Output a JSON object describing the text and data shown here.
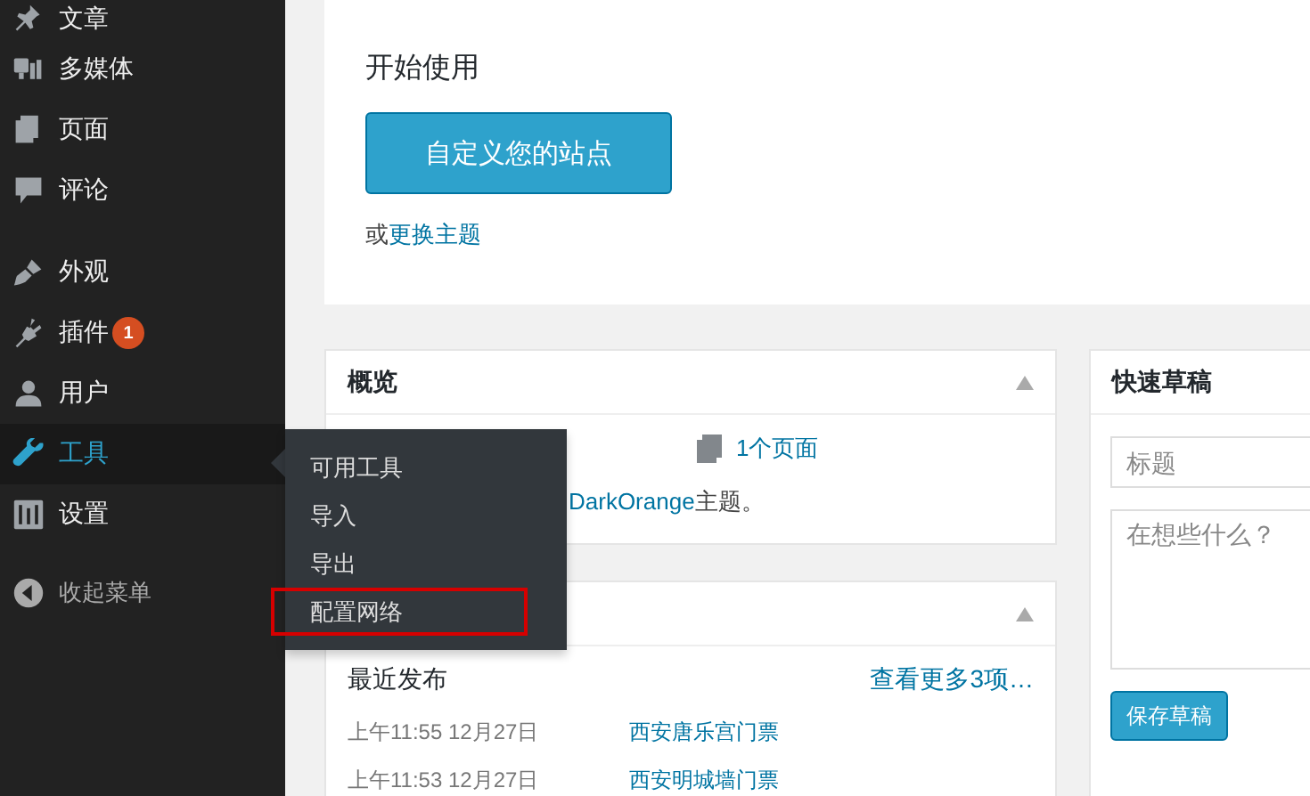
{
  "sidebar": {
    "items": [
      {
        "label": "文章",
        "selected": false
      },
      {
        "label": "多媒体",
        "selected": false
      },
      {
        "label": "页面",
        "selected": false
      },
      {
        "label": "评论",
        "selected": false
      },
      {
        "label": "外观",
        "selected": false
      },
      {
        "label": "插件",
        "selected": false,
        "badge": "1"
      },
      {
        "label": "用户",
        "selected": false
      },
      {
        "label": "工具",
        "selected": true
      },
      {
        "label": "设置",
        "selected": false
      }
    ],
    "collapse": "收起菜单"
  },
  "flyout": {
    "items": [
      {
        "label": "可用工具",
        "highlighted": false
      },
      {
        "label": "导入",
        "highlighted": false
      },
      {
        "label": "导出",
        "highlighted": false
      },
      {
        "label": "配置网络",
        "highlighted": true
      }
    ]
  },
  "welcome": {
    "heading": "开始使用",
    "button": "自定义您的站点",
    "alt_prefix": "或",
    "alt_link": "更换主题"
  },
  "overview": {
    "title": "概览",
    "pages": "1个页面",
    "theme_link": "DarkOrange",
    "theme_suffix": "主题。"
  },
  "activity": {
    "heading": "最近发布",
    "more": "查看更多3项…",
    "rows": [
      {
        "time": "上午11:55 12月27日",
        "title": "西安唐乐宫门票"
      },
      {
        "time": "上午11:53 12月27日",
        "title": "西安明城墙门票"
      }
    ]
  },
  "quick_draft": {
    "title": "快速草稿",
    "title_placeholder": "标题",
    "content_placeholder": "在想些什么？",
    "save": "保存草稿"
  }
}
